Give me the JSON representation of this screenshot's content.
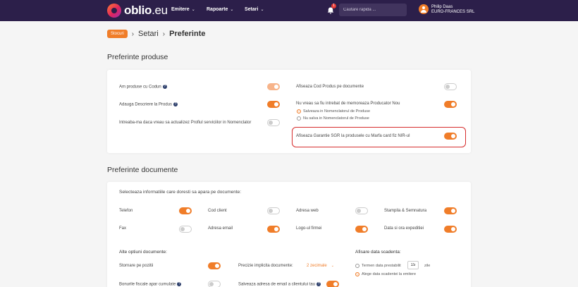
{
  "header": {
    "logo_main": "oblio",
    "logo_tld": ".eu",
    "nav": [
      {
        "label": "Emitere"
      },
      {
        "label": "Rapoarte"
      },
      {
        "label": "Setari"
      }
    ],
    "notification_count": "1",
    "search_placeholder": "Cautare rapida ...",
    "user_name": "Philip Daas",
    "user_company": "EURO-FRANCES SRL"
  },
  "breadcrumb": {
    "tag": "Stocuri",
    "items": [
      "Setari",
      "Preferinte"
    ]
  },
  "products_section": {
    "title": "Preferinte produse",
    "left": [
      {
        "label": "Am produse cu Codun",
        "help": true,
        "state": "on-light"
      },
      {
        "label": "Adauga Descriere la Produs",
        "help": true,
        "state": "on"
      },
      {
        "label": "Intreaba-ma daca vreau sa actualizez Profiul serviciilor in Nomenclator",
        "help": false,
        "state": "off"
      }
    ],
    "right": [
      {
        "label": "Afiseaza Cod Produs pe documente",
        "state": "off"
      },
      {
        "label": "Nu vreau sa fiu intrebat de memoreaza Producator Nou",
        "state": "on"
      },
      {
        "label": "Afiseaza Garantie SGR la produsele cu Marfa card fiz NIR-ul",
        "state": "on"
      }
    ],
    "radio_options": [
      {
        "label": "Salveaza in Nomenclatorul de Produse",
        "checked": true
      },
      {
        "label": "Nu salva in Nomenclatorul de Produse",
        "checked": false
      }
    ]
  },
  "documents_section": {
    "title": "Preferinte documente",
    "intro": "Selecteaza informatiile care doresti sa apara pe documente:",
    "grid": [
      [
        {
          "label": "Telefon",
          "state": "on"
        },
        {
          "label": "Cod client",
          "state": "off"
        },
        {
          "label": "Adresa web",
          "state": "off"
        },
        {
          "label": "Stampila & Semnatura",
          "state": "on"
        }
      ],
      [
        {
          "label": "Fax",
          "state": "off"
        },
        {
          "label": "Adresa email",
          "state": "on"
        },
        {
          "label": "Logo-ul firmei",
          "state": "on"
        },
        {
          "label": "Data si ora expeditiei",
          "state": "on"
        }
      ]
    ],
    "other_title": "Alte optiuni documente:",
    "other": {
      "stornare_label": "Stornare pe pozitii",
      "stornare_state": "on",
      "precizie_label": "Precizie implicita documente:",
      "precizie_value": "2 zecimale",
      "bonuri_label": "Bonurile fiscale apar cumulate",
      "bonuri_help": true,
      "bonuri_state": "off",
      "salveaza_email_label": "Salveaza adresa de email a clientului tau",
      "salveaza_email_help": true,
      "salveaza_email_state": "on"
    },
    "scadenta": {
      "title": "Afisare data scadenta:",
      "option1_prefix": "Termen data prestabilit",
      "option1_value": "15",
      "option1_suffix": "zile",
      "option1_checked": false,
      "option2": "Alege data scadentei la emitere",
      "option2_checked": true
    }
  }
}
